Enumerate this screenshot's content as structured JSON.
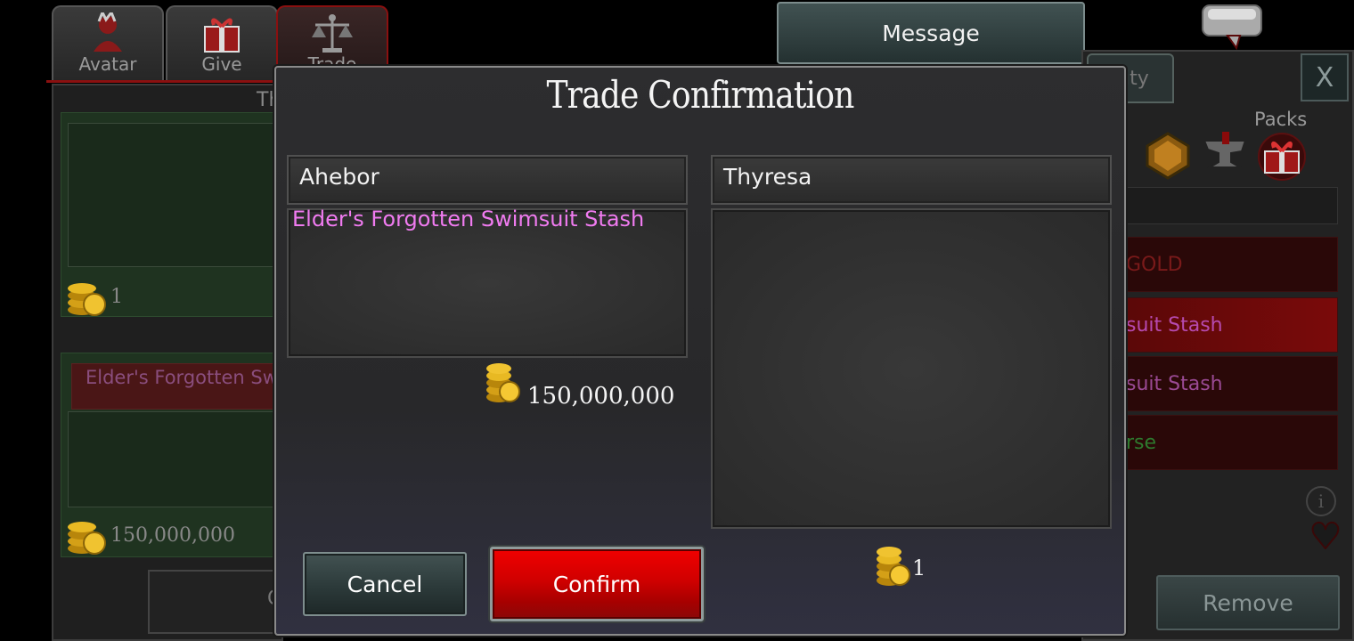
{
  "tabs": [
    {
      "label": "Avatar",
      "icon": "avatar-icon"
    },
    {
      "label": "Give",
      "icon": "gift-icon"
    },
    {
      "label": "Trade",
      "icon": "scales-icon"
    }
  ],
  "left_panel": {
    "header_partial": "Th",
    "top_gold": "1",
    "item_partial": "Elder's Forgotten Sw",
    "bottom_gold": "150,000,000",
    "button_partial": "C"
  },
  "message_button": "Message",
  "right_panel": {
    "tab_partial": "ity",
    "close_label": "X",
    "packs_label": "Packs",
    "rows": [
      {
        "text": "GOLD",
        "color": "#7a1a1a"
      },
      {
        "text": "suit Stash",
        "color": "#b64ab0"
      },
      {
        "text": "suit Stash",
        "color": "#9a4a94"
      },
      {
        "text": "rse",
        "color": "#2e7a2e"
      }
    ],
    "info_label": "i",
    "remove_button": "Remove"
  },
  "modal": {
    "title": "Trade Confirmation",
    "left_player": "Ahebor",
    "left_items": [
      "Elder's Forgotten Swimsuit Stash"
    ],
    "left_gold": "150,000,000",
    "right_player": "Thyresa",
    "right_items": [],
    "right_gold": "1",
    "cancel_label": "Cancel",
    "confirm_label": "Confirm"
  },
  "colors": {
    "item_name": "#f07bf0",
    "confirm": "#e00000",
    "panel_green": "#1f3320"
  }
}
